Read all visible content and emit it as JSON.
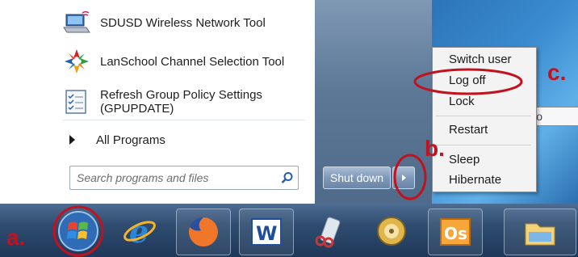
{
  "start_menu": {
    "programs": [
      {
        "label": "SDUSD Wireless Network Tool",
        "icon": "laptop-wireless-icon"
      },
      {
        "label": "LanSchool Channel Selection Tool",
        "icon": "lanschool-icon"
      },
      {
        "label_line1": "Refresh Group Policy Settings",
        "label_line2": "(GPUPDATE)",
        "icon": "checklist-icon"
      }
    ],
    "all_programs": "All Programs",
    "search_placeholder": "Search programs and files"
  },
  "shutdown": {
    "label": "Shut down"
  },
  "submenu": {
    "items": [
      "Switch user",
      "Log off",
      "Lock",
      "Restart",
      "Sleep",
      "Hibernate"
    ]
  },
  "tooltip": {
    "text": "Clo"
  },
  "taskbar": {
    "items": [
      "start-orb",
      "internet-explorer",
      "firefox",
      "word",
      "snipping-tool",
      "media-player",
      "outlook",
      "file-explorer"
    ]
  },
  "annotations": {
    "a": "a.",
    "b": "b.",
    "c": "c."
  },
  "colors": {
    "annotation": "#c1121f",
    "taskbar": "#2f4c70"
  }
}
